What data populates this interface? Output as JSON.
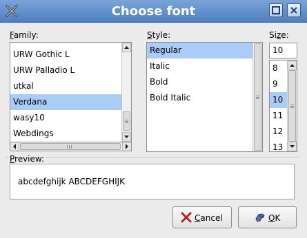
{
  "window": {
    "title": "Choose font",
    "icon": "x-icon",
    "maximize_icon": "maximize-icon",
    "close_icon": "close-icon"
  },
  "family": {
    "label_mnemonic": "F",
    "label_rest": "amily:",
    "items": [
      "URW Gothic L",
      "URW Palladio L",
      "utkal",
      "Verdana",
      "wasy10",
      "Webdings"
    ],
    "selected": "Verdana"
  },
  "style": {
    "label_mnemonic": "S",
    "label_rest": "tyle:",
    "items": [
      "Regular",
      "Italic",
      "Bold",
      "Bold Italic"
    ],
    "selected": "Regular"
  },
  "size": {
    "label_prefix": "Si",
    "label_mnemonic": "z",
    "label_rest": "e:",
    "value": "10",
    "items": [
      "8",
      "9",
      "10",
      "11",
      "12",
      "13"
    ],
    "selected": "10"
  },
  "preview": {
    "label_mnemonic": "P",
    "label_rest": "review:",
    "text": "abcdefghijk ABCDEFGHIJK"
  },
  "buttons": {
    "cancel_mnemonic": "C",
    "cancel_rest": "ancel",
    "ok_mnemonic": "O",
    "ok_rest": "K",
    "cancel_icon": "cancel-x-icon",
    "ok_icon": "ok-hand-icon"
  },
  "colors": {
    "titlebar": "#5b8ac8",
    "selection": "#a9cdf6"
  }
}
